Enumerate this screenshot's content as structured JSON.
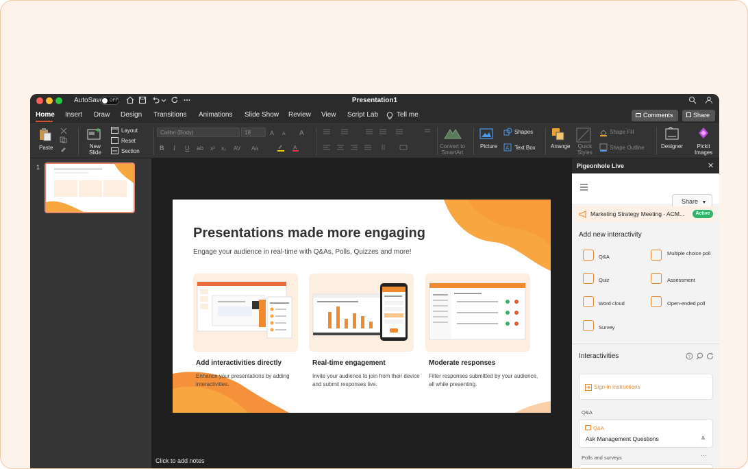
{
  "titlebar": {
    "autosave_label": "AutoSave",
    "toggle_state": "OFF",
    "document_title": "Presentation1"
  },
  "tabs": [
    "Home",
    "Insert",
    "Draw",
    "Design",
    "Transitions",
    "Animations",
    "Slide Show",
    "Review",
    "View",
    "Script Lab"
  ],
  "tell_me": "Tell me",
  "header_buttons": {
    "comments": "Comments",
    "share": "Share"
  },
  "ribbon": {
    "paste": "Paste",
    "new_slide": "New\nSlide",
    "layout": "Layout",
    "reset": "Reset",
    "section": "Section",
    "font_name": "Calibri (Body)",
    "font_size": "18",
    "convert_smartart": "Convert to\nSmartArt",
    "picture": "Picture",
    "shapes": "Shapes",
    "text_box": "Text Box",
    "arrange": "Arrange",
    "quick_styles": "Quick\nStyles",
    "shape_fill": "Shape Fill",
    "shape_outline": "Shape Outline",
    "designer": "Designer",
    "pickit": "Pickit\nImages"
  },
  "thumbnails": {
    "slide_number": "1"
  },
  "slide": {
    "title": "Presentations made more engaging",
    "subtitle": "Engage your audience in real-time with Q&As, Polls, Quizzes and more!",
    "cards": [
      {
        "title": "Add interactivities directly",
        "desc": "Enhance your presentations by adding interactivities."
      },
      {
        "title": "Real-time engagement",
        "desc": "Invite your audience to join from their device and submit responses live."
      },
      {
        "title": "Moderate responses",
        "desc": "Filter responses submitted by your audience, all while presenting."
      }
    ]
  },
  "notes_placeholder": "Click to add notes",
  "panel": {
    "title": "Pigeonhole Live",
    "share": "Share",
    "meeting": "Marketing Strategy Meeting - ACM...",
    "status": "Active",
    "add_heading": "Add new interactivity",
    "options": [
      {
        "label": "Q&A",
        "icon": "qa-icon"
      },
      {
        "label": "Multiple choice poll",
        "icon": "bar-chart-icon"
      },
      {
        "label": "Quiz",
        "icon": "quiz-icon"
      },
      {
        "label": "Assessment",
        "icon": "assessment-icon"
      },
      {
        "label": "Word cloud",
        "icon": "word-cloud-icon"
      },
      {
        "label": "Open-ended poll",
        "icon": "open-poll-icon"
      },
      {
        "label": "Survey",
        "icon": "survey-icon"
      }
    ],
    "interactivities_heading": "Interactivities",
    "sign_in": "Sign-in instructions",
    "qa_section": "Q&A",
    "qa_tag": "Q&A",
    "qa_title": "Ask Management Questions",
    "polls_section": "Polls and surveys"
  },
  "colors": {
    "accent": "#e9892d",
    "tab_underline": "#d35230",
    "active": "#2fb36a"
  }
}
